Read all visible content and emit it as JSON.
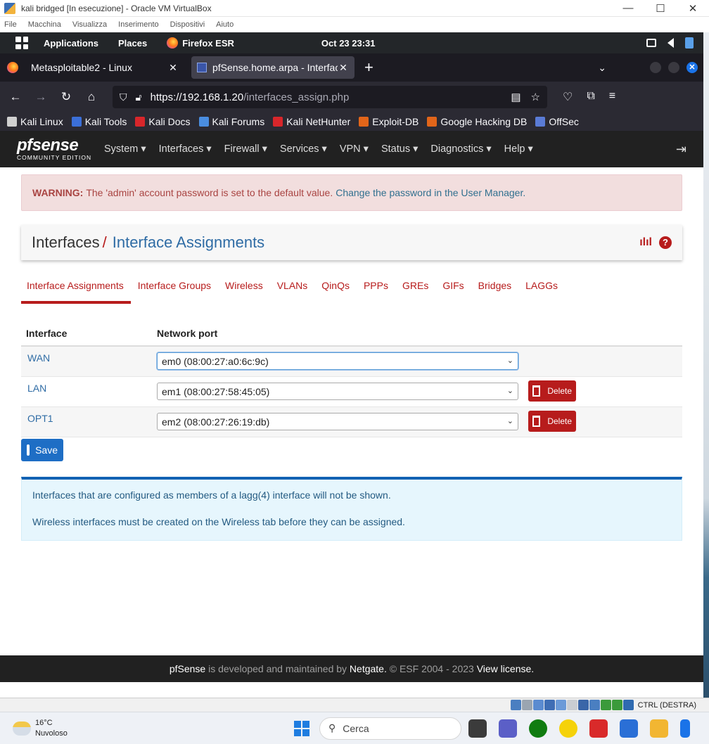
{
  "vbox": {
    "title": "kali bridged [In esecuzione] - Oracle VM VirtualBox",
    "menu": [
      "File",
      "Macchina",
      "Visualizza",
      "Inserimento",
      "Dispositivi",
      "Aiuto"
    ],
    "window_controls": [
      "—",
      "☐",
      "✕"
    ],
    "status_text": "CTRL (DESTRA)"
  },
  "kali_panel": {
    "applications": "Applications",
    "places": "Places",
    "browser": "Firefox ESR",
    "clock": "Oct 23  23:31"
  },
  "firefox": {
    "tabs": [
      {
        "title": "Metasploitable2 - Linux",
        "active": false
      },
      {
        "title": "pfSense.home.arpa - Interface Assignments",
        "active": true
      }
    ],
    "url_host": "https://192.168.1.20",
    "url_path": "/interfaces_assign.php",
    "bookmarks": [
      {
        "label": "Kali Linux",
        "icon": "kali-dragon-icon",
        "color": "#d0d0d0"
      },
      {
        "label": "Kali Tools",
        "icon": "kali-tools-icon",
        "color": "#3b6fd8"
      },
      {
        "label": "Kali Docs",
        "icon": "kali-docs-icon",
        "color": "#d8262b"
      },
      {
        "label": "Kali Forums",
        "icon": "kali-forums-icon",
        "color": "#4a8de0"
      },
      {
        "label": "Kali NetHunter",
        "icon": "kali-nethunter-icon",
        "color": "#d8262b"
      },
      {
        "label": "Exploit-DB",
        "icon": "exploit-db-icon",
        "color": "#e2651a"
      },
      {
        "label": "Google Hacking DB",
        "icon": "ghdb-icon",
        "color": "#e2651a"
      },
      {
        "label": "OffSec",
        "icon": "offsec-icon",
        "color": "#5a7bd6"
      }
    ]
  },
  "pfsense": {
    "logo_main": "pfsense",
    "logo_sub": "COMMUNITY EDITION",
    "menu": [
      "System",
      "Interfaces",
      "Firewall",
      "Services",
      "VPN",
      "Status",
      "Diagnostics",
      "Help"
    ],
    "alert": {
      "label": "WARNING:",
      "text": "The 'admin' account password is set to the default value.",
      "link": "Change the password in the User Manager."
    },
    "breadcrumb": {
      "parent": "Interfaces",
      "sep": "/",
      "current": "Interface Assignments"
    },
    "tabs": [
      "Interface Assignments",
      "Interface Groups",
      "Wireless",
      "VLANs",
      "QinQs",
      "PPPs",
      "GREs",
      "GIFs",
      "Bridges",
      "LAGGs"
    ],
    "table": {
      "headers": [
        "Interface",
        "Network port"
      ],
      "rows": [
        {
          "iface": "WAN",
          "port": "em0 (08:00:27:a0:6c:9c)",
          "delete": false
        },
        {
          "iface": "LAN",
          "port": "em1 (08:00:27:58:45:05)",
          "delete": true
        },
        {
          "iface": "OPT1",
          "port": "em2 (08:00:27:26:19:db)",
          "delete": true
        }
      ],
      "delete_label": "Delete"
    },
    "save_label": "Save",
    "info": [
      "Interfaces that are configured as members of a lagg(4) interface will not be shown.",
      "Wireless interfaces must be created on the Wireless tab before they can be assigned."
    ],
    "footer": {
      "brand": "pfSense",
      "text1": " is developed and maintained by ",
      "netgate": "Netgate.",
      "text2": " © ESF 2004 - 2023 ",
      "license": "View license."
    },
    "colors": {
      "accent_red": "#b71c1c",
      "link_blue": "#2f6ca5",
      "nav_bg": "#212121"
    }
  },
  "windows": {
    "temperature": "16°C",
    "weather": "Nuvoloso",
    "search_placeholder": "Cerca"
  }
}
